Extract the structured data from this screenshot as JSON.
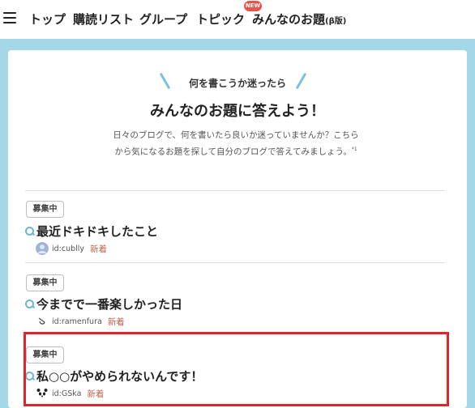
{
  "nav": {
    "items": [
      "トップ",
      "購読リスト",
      "グループ",
      "トピック"
    ],
    "odai_label": "みんなのお題",
    "odai_beta": "(β版)",
    "new_badge": "NEW"
  },
  "hero": {
    "eyebrow": "何を書こうか迷ったら",
    "headline": "みんなのお題に答えよう！",
    "description": "日々のブログで、何を書いたら良いか迷っていませんか？こちらから気になるお題を探して自分のブログで答えてみましょう。",
    "footnote": "*1"
  },
  "topics": [
    {
      "status": "募集中",
      "title": "最近ドキドキしたこと",
      "author": "id:cublly",
      "label": "新着",
      "avatar": "person-avatar"
    },
    {
      "status": "募集中",
      "title": "今までで一番楽しかった日",
      "author": "id:ramenfura",
      "label": "新着",
      "avatar": "ramen-avatar"
    },
    {
      "status": "募集中",
      "title": "私○○がやめられないんです！",
      "author": "id:GSka",
      "label": "新着",
      "avatar": "panda-avatar"
    }
  ],
  "colors": {
    "panel": "#a5d8e7",
    "accent": "#6eb5cf",
    "highlight_border": "#e52227",
    "new_badge": "#e8534a",
    "new_label": "#c0634a"
  }
}
